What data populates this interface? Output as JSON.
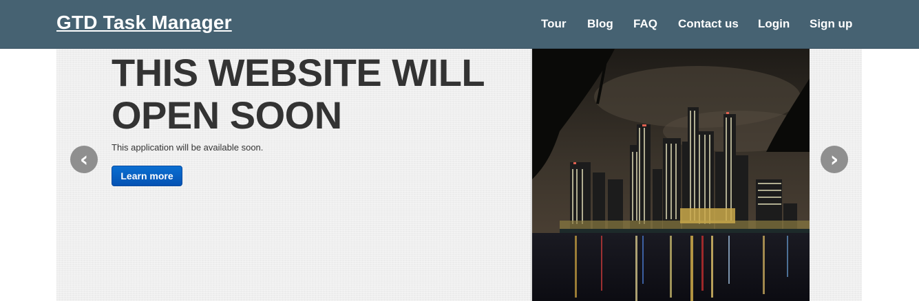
{
  "app": {
    "title": "GTD Task Manager"
  },
  "nav": {
    "items": [
      "Tour",
      "Blog",
      "FAQ",
      "Contact us",
      "Login",
      "Sign up"
    ]
  },
  "hero": {
    "headline_line1": "THIS WEBSITE WILL",
    "headline_line2": "OPEN SOON",
    "lead": "This application will be available soon.",
    "button_label": "Learn more"
  },
  "carousel": {
    "prev_icon": "chevron-left-icon",
    "next_icon": "chevron-right-icon",
    "prev_glyph": "‹",
    "next_glyph": "›"
  },
  "colors": {
    "navbar": "#466272",
    "button": "#0a6fd1",
    "headline": "#333333"
  }
}
